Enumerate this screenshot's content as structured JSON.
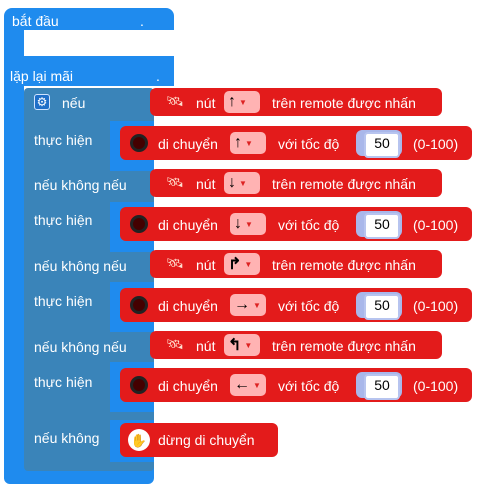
{
  "start_block": {
    "label": "bắt đầu",
    "dot": "."
  },
  "forever_block": {
    "label": "lặp lại mãi",
    "dot": "."
  },
  "if_block": {
    "gear_icon": "⚙",
    "if_label": "nếu",
    "do_label": "thực hiện",
    "else_if_label": "nếu không nếu",
    "else_label": "nếu không"
  },
  "conditions": [
    {
      "button_label": "nút",
      "direction": "↑",
      "suffix": "trên remote được nhấn"
    },
    {
      "button_label": "nút",
      "direction": "↓",
      "suffix": "trên remote được nhấn"
    },
    {
      "button_label": "nút",
      "direction": "↱",
      "suffix": "trên remote được nhấn"
    },
    {
      "button_label": "nút",
      "direction": "↰",
      "suffix": "trên remote được nhấn"
    }
  ],
  "move_blocks": [
    {
      "label": "di chuyển",
      "direction": "↑",
      "speed_label": "với tốc độ",
      "speed": "50",
      "range": "(0-100)"
    },
    {
      "label": "di chuyển",
      "direction": "↓",
      "speed_label": "với tốc độ",
      "speed": "50",
      "range": "(0-100)"
    },
    {
      "label": "di chuyển",
      "direction": "→",
      "speed_label": "với tốc độ",
      "speed": "50",
      "range": "(0-100)"
    },
    {
      "label": "di chuyển",
      "direction": "←",
      "speed_label": "với tốc độ",
      "speed": "50",
      "range": "(0-100)"
    }
  ],
  "stop_block": {
    "label": "dừng di chuyển",
    "icon": "✋"
  },
  "colors": {
    "event_blue": "#1f8bee",
    "control_blue": "#3a84b9",
    "robot_red": "#e31b1b",
    "dropdown_pink": "#ffb3b3"
  },
  "icons": {
    "remote": "remote-icon",
    "wheel": "wheel-icon",
    "stop": "hand-stop-icon",
    "gear": "gear-icon"
  }
}
